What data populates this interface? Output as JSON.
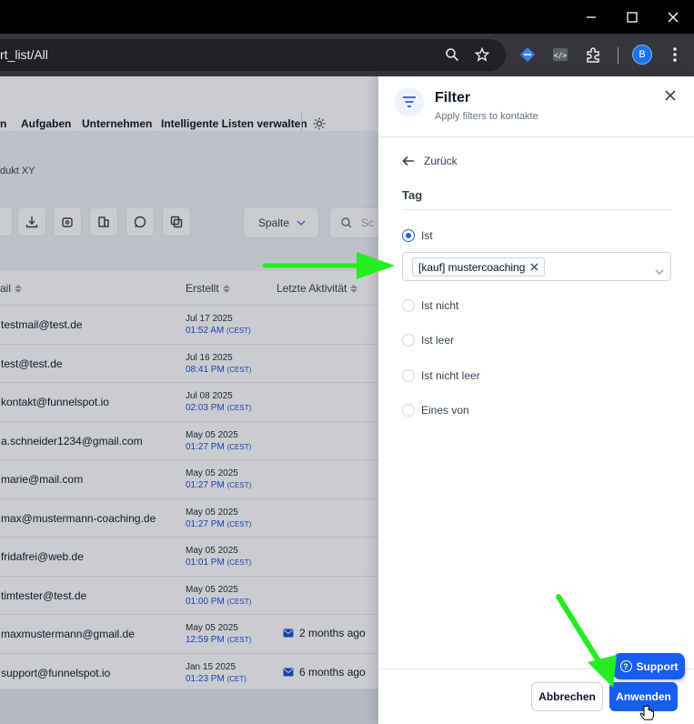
{
  "browser": {
    "url_fragment": "rt_list/All",
    "profile_initial": "B"
  },
  "nav": {
    "items": [
      "n",
      "Aufgaben",
      "Unternehmen",
      "Intelligente Listen verwalten"
    ]
  },
  "breadcrumb": "dukt XY",
  "toolbar": {
    "column_button": "Spalte",
    "search_placeholder": "Sc"
  },
  "table": {
    "headers": {
      "email": "ail",
      "created": "Erstellt",
      "last_activity": "Letzte Aktivität"
    },
    "rows": [
      {
        "email": "testmail@test.de",
        "date": "Jul 17 2025",
        "time": "01:52 AM",
        "tz": "(CEST)",
        "activity": ""
      },
      {
        "email": "test@test.de",
        "date": "Jul 16 2025",
        "time": "08:41 PM",
        "tz": "(CEST)",
        "activity": ""
      },
      {
        "email": "kontakt@funnelspot.io",
        "date": "Jul 08 2025",
        "time": "02:03 PM",
        "tz": "(CEST)",
        "activity": ""
      },
      {
        "email": "a.schneider1234@gmail.com",
        "date": "May 05 2025",
        "time": "01:27 PM",
        "tz": "(CEST)",
        "activity": ""
      },
      {
        "email": "marie@mail.com",
        "date": "May 05 2025",
        "time": "01:27 PM",
        "tz": "(CEST)",
        "activity": ""
      },
      {
        "email": "max@mustermann-coaching.de",
        "date": "May 05 2025",
        "time": "01:27 PM",
        "tz": "(CEST)",
        "activity": ""
      },
      {
        "email": "fridafrei@web.de",
        "date": "May 05 2025",
        "time": "01:01 PM",
        "tz": "(CEST)",
        "activity": ""
      },
      {
        "email": "timtester@test.de",
        "date": "May 05 2025",
        "time": "01:00 PM",
        "tz": "(CEST)",
        "activity": ""
      },
      {
        "email": "maxmustermann@gmail.de",
        "date": "May 05 2025",
        "time": "12:59 PM",
        "tz": "(CEST)",
        "activity": "2 months ago"
      },
      {
        "email": "support@funnelspot.io",
        "date": "Jan 15 2025",
        "time": "01:23 PM",
        "tz": "(CET)",
        "activity": "6 months ago"
      }
    ]
  },
  "drawer": {
    "title": "Filter",
    "subtitle": "Apply filters to kontakte",
    "back_label": "Zurück",
    "section_label": "Tag",
    "options": [
      "Ist",
      "Ist nicht",
      "Ist leer",
      "Ist nicht leer",
      "Eines von"
    ],
    "selected_option": "Ist",
    "selected_tag": "[kauf] mustercoaching",
    "cancel_label": "Abbrechen",
    "apply_label": "Anwenden"
  },
  "support_label": "Support",
  "colors": {
    "accent": "#155eef",
    "annotation_arrow": "#22ee22"
  }
}
